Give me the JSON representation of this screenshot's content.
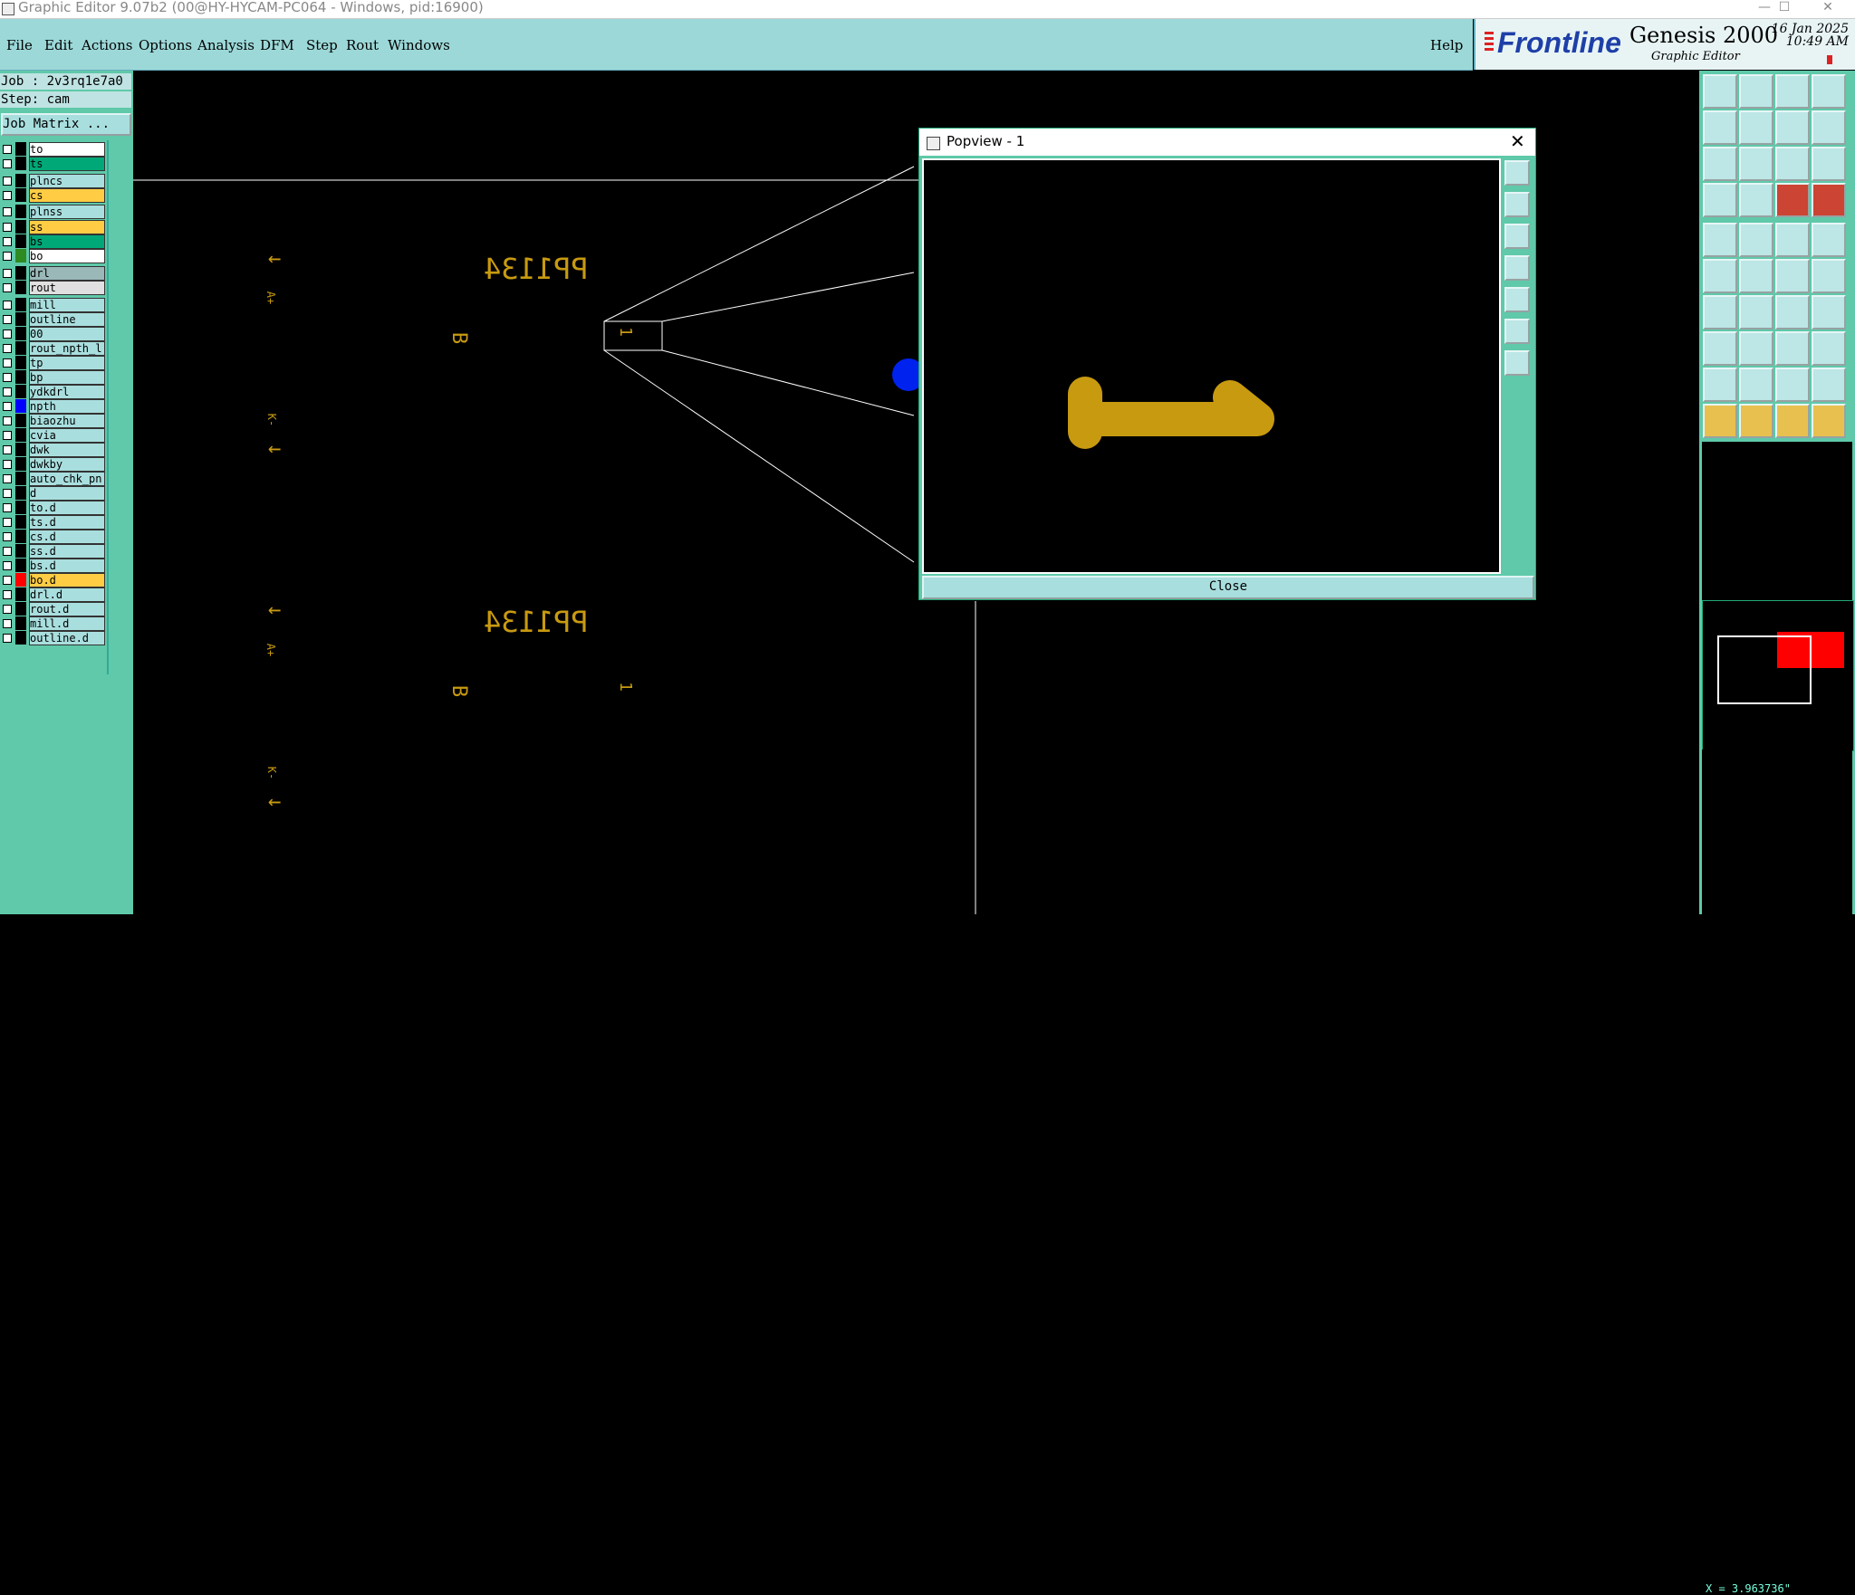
{
  "window": {
    "title": "Graphic Editor 9.07b2 (00@HY-HYCAM-PC064 - Windows, pid:16900)",
    "minimize_glyph": "—",
    "maximize_glyph": "☐",
    "close_glyph": "✕"
  },
  "menu": [
    "File",
    "Edit",
    "Actions",
    "Options",
    "Analysis",
    "DFM",
    "Step",
    "Rout",
    "Windows"
  ],
  "help": "Help",
  "logo": {
    "brand": "Frontline",
    "product": "Genesis 2000",
    "subtitle": "Graphic Editor",
    "date": "16 Jan 2025",
    "time": "10:49 AM"
  },
  "job": {
    "job_label": "Job : 2v3rq1e7a0",
    "step_label": "Step: cam",
    "job_matrix_button": "Job Matrix ..."
  },
  "layers": [
    {
      "name": "to",
      "color": "#ffffff",
      "swatch": "#000000"
    },
    {
      "name": "ts",
      "color": "#00a878",
      "swatch": "#000000"
    },
    {
      "name": "plncs",
      "color": "#a9dede",
      "swatch": "#000000"
    },
    {
      "name": "cs",
      "color": "#ffcc44",
      "swatch": "#000000"
    },
    {
      "name": "plnss",
      "color": "#a9dede",
      "swatch": "#000000"
    },
    {
      "name": "ss",
      "color": "#ffcc44",
      "swatch": "#000000"
    },
    {
      "name": "bs",
      "color": "#00a878",
      "swatch": "#000000"
    },
    {
      "name": "bo",
      "color": "#ffffff",
      "swatch": "#2e8b22"
    },
    {
      "name": "drl",
      "color": "#9ab8b8",
      "swatch": "#000000"
    },
    {
      "name": "rout",
      "color": "#e0e0e0",
      "swatch": "#000000"
    },
    {
      "name": "mill",
      "color": "#a9dede",
      "swatch": "#000000"
    },
    {
      "name": "outline",
      "color": "#a9dede",
      "swatch": "#000000"
    },
    {
      "name": "00",
      "color": "#a9dede",
      "swatch": "#000000"
    },
    {
      "name": "rout_npth_l",
      "color": "#a9dede",
      "swatch": "#000000"
    },
    {
      "name": "tp",
      "color": "#a9dede",
      "swatch": "#000000"
    },
    {
      "name": "bp",
      "color": "#a9dede",
      "swatch": "#000000"
    },
    {
      "name": "ydkdrl",
      "color": "#a9dede",
      "swatch": "#000000"
    },
    {
      "name": "npth",
      "color": "#a9dede",
      "swatch": "#0000ff"
    },
    {
      "name": "biaozhu",
      "color": "#a9dede",
      "swatch": "#000000"
    },
    {
      "name": "cvia",
      "color": "#a9dede",
      "swatch": "#000000"
    },
    {
      "name": "dwk",
      "color": "#a9dede",
      "swatch": "#000000"
    },
    {
      "name": "dwkby",
      "color": "#a9dede",
      "swatch": "#000000"
    },
    {
      "name": "auto_chk_pn",
      "color": "#a9dede",
      "swatch": "#000000"
    },
    {
      "name": "d",
      "color": "#a9dede",
      "swatch": "#000000"
    },
    {
      "name": "to.d",
      "color": "#a9dede",
      "swatch": "#000000"
    },
    {
      "name": "ts.d",
      "color": "#a9dede",
      "swatch": "#000000"
    },
    {
      "name": "cs.d",
      "color": "#a9dede",
      "swatch": "#000000"
    },
    {
      "name": "ss.d",
      "color": "#a9dede",
      "swatch": "#000000"
    },
    {
      "name": "bs.d",
      "color": "#a9dede",
      "swatch": "#000000"
    },
    {
      "name": "bo.d",
      "color": "#ffcc44",
      "swatch": "#ff0000"
    },
    {
      "name": "drl.d",
      "color": "#a9dede",
      "swatch": "#000000"
    },
    {
      "name": "rout.d",
      "color": "#a9dede",
      "swatch": "#000000"
    },
    {
      "name": "mill.d",
      "color": "#a9dede",
      "swatch": "#000000"
    },
    {
      "name": "outline.d",
      "color": "#a9dede",
      "swatch": "#000000"
    }
  ],
  "canvas_text": {
    "part_number": "PP1134",
    "b_mark": "B",
    "one_mark": "1",
    "a_plus": "A+",
    "k_minus": "K-",
    "arrow": "←"
  },
  "popview": {
    "title": "Popview - 1",
    "close_glyph": "✕",
    "close_button": "Close"
  },
  "coord_readout": "X = 3.963736\"",
  "colors": {
    "panel": "#5fc9a9",
    "menubar": "#9cd8d8",
    "feature_yellow": "#c89a10",
    "pad_blue": "#0022ee"
  }
}
